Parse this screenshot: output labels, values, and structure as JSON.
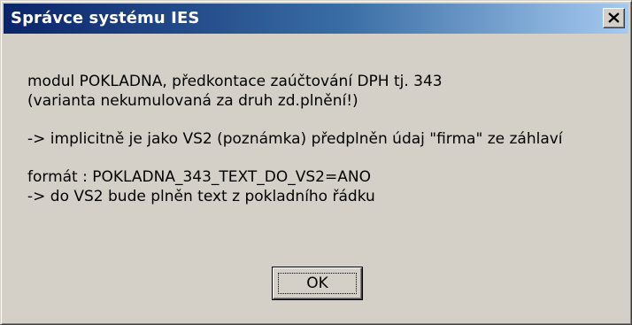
{
  "dialog": {
    "title": "Správce systému IES",
    "close_icon": "close-icon",
    "message_lines": [
      "modul POKLADNA, předkontace zaúčtování DPH tj. 343",
      "(varianta nekumulovaná za druh zd.plnění!)",
      "",
      "-> implicitně je jako VS2 (poznámka) předplněn údaj \"firma\" ze záhlaví",
      "",
      "formát : POKLADNA_343_TEXT_DO_VS2=ANO",
      "-> do VS2 bude plněn text z pokladního řádku"
    ],
    "ok_label": "OK"
  },
  "colors": {
    "face": "#d4d0c8",
    "titlebar_start": "#0a246a",
    "titlebar_end": "#a6caf0",
    "title_text": "#ffffff"
  }
}
